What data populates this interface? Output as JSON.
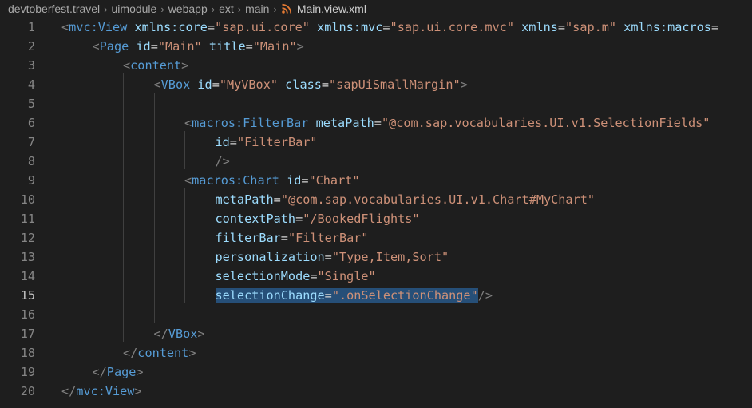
{
  "breadcrumb": {
    "items": [
      "devtoberfest.travel",
      "uimodule",
      "webapp",
      "ext",
      "main"
    ],
    "file": "Main.view.xml",
    "file_icon": "rss-icon",
    "file_icon_color": "#e37933"
  },
  "editor": {
    "current_line": 15,
    "selection_color": "#264f78",
    "lines": [
      {
        "n": "1",
        "indent": 0,
        "tokens": [
          {
            "c": "t-punc",
            "v": "<"
          },
          {
            "c": "t-tag",
            "v": "mvc:View"
          },
          {
            "c": "t-txt",
            "v": " "
          },
          {
            "c": "t-attr",
            "v": "xmlns:core"
          },
          {
            "c": "t-eq",
            "v": "="
          },
          {
            "c": "t-str",
            "v": "\"sap.ui.core\""
          },
          {
            "c": "t-txt",
            "v": " "
          },
          {
            "c": "t-attr",
            "v": "xmlns:mvc"
          },
          {
            "c": "t-eq",
            "v": "="
          },
          {
            "c": "t-str",
            "v": "\"sap.ui.core.mvc\""
          },
          {
            "c": "t-txt",
            "v": " "
          },
          {
            "c": "t-attr",
            "v": "xmlns"
          },
          {
            "c": "t-eq",
            "v": "="
          },
          {
            "c": "t-str",
            "v": "\"sap.m\""
          },
          {
            "c": "t-txt",
            "v": " "
          },
          {
            "c": "t-attr",
            "v": "xmlns:macros"
          },
          {
            "c": "t-eq",
            "v": "="
          }
        ]
      },
      {
        "n": "2",
        "indent": 1,
        "tokens": [
          {
            "c": "t-punc",
            "v": "<"
          },
          {
            "c": "t-tag",
            "v": "Page"
          },
          {
            "c": "t-txt",
            "v": " "
          },
          {
            "c": "t-attr",
            "v": "id"
          },
          {
            "c": "t-eq",
            "v": "="
          },
          {
            "c": "t-str",
            "v": "\"Main\""
          },
          {
            "c": "t-txt",
            "v": " "
          },
          {
            "c": "t-attr",
            "v": "title"
          },
          {
            "c": "t-eq",
            "v": "="
          },
          {
            "c": "t-str",
            "v": "\"Main\""
          },
          {
            "c": "t-punc",
            "v": ">"
          }
        ]
      },
      {
        "n": "3",
        "indent": 2,
        "tokens": [
          {
            "c": "t-punc",
            "v": "<"
          },
          {
            "c": "t-tag",
            "v": "content"
          },
          {
            "c": "t-punc",
            "v": ">"
          }
        ]
      },
      {
        "n": "4",
        "indent": 3,
        "tokens": [
          {
            "c": "t-punc",
            "v": "<"
          },
          {
            "c": "t-tag",
            "v": "VBox"
          },
          {
            "c": "t-txt",
            "v": " "
          },
          {
            "c": "t-attr",
            "v": "id"
          },
          {
            "c": "t-eq",
            "v": "="
          },
          {
            "c": "t-str",
            "v": "\"MyVBox\""
          },
          {
            "c": "t-txt",
            "v": " "
          },
          {
            "c": "t-attr",
            "v": "class"
          },
          {
            "c": "t-eq",
            "v": "="
          },
          {
            "c": "t-str",
            "v": "\"sapUiSmallMargin\""
          },
          {
            "c": "t-punc",
            "v": ">"
          }
        ]
      },
      {
        "n": "5",
        "indent": 0,
        "tokens": []
      },
      {
        "n": "6",
        "indent": 4,
        "tokens": [
          {
            "c": "t-punc",
            "v": "<"
          },
          {
            "c": "t-tag",
            "v": "macros:FilterBar"
          },
          {
            "c": "t-txt",
            "v": " "
          },
          {
            "c": "t-attr",
            "v": "metaPath"
          },
          {
            "c": "t-eq",
            "v": "="
          },
          {
            "c": "t-str",
            "v": "\"@com.sap.vocabularies.UI.v1.SelectionFields\""
          }
        ]
      },
      {
        "n": "7",
        "indent": 5,
        "tokens": [
          {
            "c": "t-attr",
            "v": "id"
          },
          {
            "c": "t-eq",
            "v": "="
          },
          {
            "c": "t-str",
            "v": "\"FilterBar\""
          }
        ]
      },
      {
        "n": "8",
        "indent": 5,
        "tokens": [
          {
            "c": "t-punc",
            "v": "/>"
          }
        ]
      },
      {
        "n": "9",
        "indent": 4,
        "tokens": [
          {
            "c": "t-punc",
            "v": "<"
          },
          {
            "c": "t-tag",
            "v": "macros:Chart"
          },
          {
            "c": "t-txt",
            "v": " "
          },
          {
            "c": "t-attr",
            "v": "id"
          },
          {
            "c": "t-eq",
            "v": "="
          },
          {
            "c": "t-str",
            "v": "\"Chart\""
          }
        ]
      },
      {
        "n": "10",
        "indent": 5,
        "tokens": [
          {
            "c": "t-attr",
            "v": "metaPath"
          },
          {
            "c": "t-eq",
            "v": "="
          },
          {
            "c": "t-str",
            "v": "\"@com.sap.vocabularies.UI.v1.Chart#MyChart\""
          }
        ]
      },
      {
        "n": "11",
        "indent": 5,
        "tokens": [
          {
            "c": "t-attr",
            "v": "contextPath"
          },
          {
            "c": "t-eq",
            "v": "="
          },
          {
            "c": "t-str",
            "v": "\"/BookedFlights\""
          }
        ]
      },
      {
        "n": "12",
        "indent": 5,
        "tokens": [
          {
            "c": "t-attr",
            "v": "filterBar"
          },
          {
            "c": "t-eq",
            "v": "="
          },
          {
            "c": "t-str",
            "v": "\"FilterBar\""
          }
        ]
      },
      {
        "n": "13",
        "indent": 5,
        "tokens": [
          {
            "c": "t-attr",
            "v": "personalization"
          },
          {
            "c": "t-eq",
            "v": "="
          },
          {
            "c": "t-str",
            "v": "\"Type,Item,Sort\""
          }
        ]
      },
      {
        "n": "14",
        "indent": 5,
        "tokens": [
          {
            "c": "t-attr",
            "v": "selectionMode"
          },
          {
            "c": "t-eq",
            "v": "="
          },
          {
            "c": "t-str",
            "v": "\"Single\""
          }
        ]
      },
      {
        "n": "15",
        "indent": 5,
        "tokens": [
          {
            "c": "t-attr",
            "v": "selectionChange",
            "sel": true
          },
          {
            "c": "t-eq",
            "v": "=",
            "sel": true
          },
          {
            "c": "t-str",
            "v": "\".onSelectionChange\"",
            "sel": true
          },
          {
            "c": "t-punc",
            "v": "/>"
          }
        ]
      },
      {
        "n": "16",
        "indent": 0,
        "tokens": []
      },
      {
        "n": "17",
        "indent": 3,
        "tokens": [
          {
            "c": "t-punc",
            "v": "</"
          },
          {
            "c": "t-tag",
            "v": "VBox"
          },
          {
            "c": "t-punc",
            "v": ">"
          }
        ]
      },
      {
        "n": "18",
        "indent": 2,
        "tokens": [
          {
            "c": "t-punc",
            "v": "</"
          },
          {
            "c": "t-tag",
            "v": "content"
          },
          {
            "c": "t-punc",
            "v": ">"
          }
        ]
      },
      {
        "n": "19",
        "indent": 1,
        "tokens": [
          {
            "c": "t-punc",
            "v": "</"
          },
          {
            "c": "t-tag",
            "v": "Page"
          },
          {
            "c": "t-punc",
            "v": ">"
          }
        ]
      },
      {
        "n": "20",
        "indent": 0,
        "tokens": [
          {
            "c": "t-punc",
            "v": "</"
          },
          {
            "c": "t-tag",
            "v": "mvc:View"
          },
          {
            "c": "t-punc",
            "v": ">"
          }
        ]
      }
    ]
  }
}
